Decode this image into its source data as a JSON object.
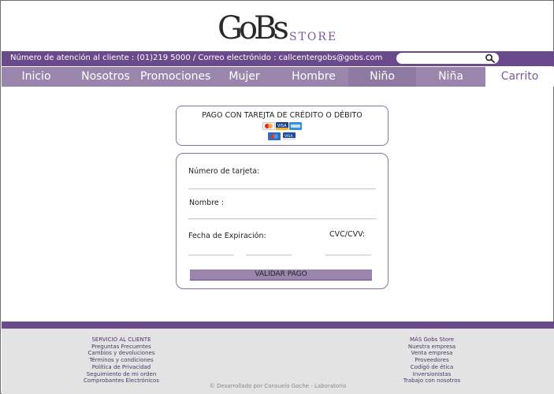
{
  "header": {
    "logo_mark": "GoBs",
    "logo_store": "STORE"
  },
  "contact": {
    "text": "Número de atención al cliente : (01)219 5000 / Correo electrónido : callcentergobs@gobs.com"
  },
  "search": {
    "placeholder": ""
  },
  "nav": {
    "items": [
      {
        "label": "Inicio"
      },
      {
        "label": "Nosotros"
      },
      {
        "label": "Promociones"
      },
      {
        "label": "Mujer"
      },
      {
        "label": "Hombre"
      },
      {
        "label": "Niño"
      },
      {
        "label": "Niña"
      },
      {
        "label": "Carrito"
      }
    ]
  },
  "payment": {
    "title": "PAGO CON TAREJTA DE CRÉDITO O DÉBITO",
    "card_logos": [
      "mastercard-icon",
      "visa-icon",
      "amex-icon",
      "maestro-icon",
      "visa-electron-icon"
    ]
  },
  "form": {
    "card_number_label": "Número de tarjeta:",
    "name_label": "Nombre :",
    "expiry_label": "Fecha de Expiración:",
    "cvc_label": "CVC/CVV:",
    "validate_label": "VALIDAR PAGO"
  },
  "footer": {
    "left_items": [
      "SERVICIO AL CLIENTE",
      "Preguntas Frecuentes",
      "Cambios y devoluciones",
      "Términos y condiciones",
      "Política de Privacidad",
      "Seguimiento de mi orden",
      "Comprobantes Electrónicos"
    ],
    "right_items": [
      "MÁS Gobs Store",
      "Nuestra empresa",
      "Venta empresa",
      "Proveedores",
      "Codigó de ética",
      "Inversionistas",
      "Trabajo con nosotros"
    ],
    "copyright": "© Desarrollado por Consuelo Goche - Laboratorio"
  },
  "colors": {
    "primary": "#6a4a8a",
    "nav": "#9a86ad",
    "accent_text": "#7a5c9a",
    "footer_bg": "#e3e3e3"
  }
}
